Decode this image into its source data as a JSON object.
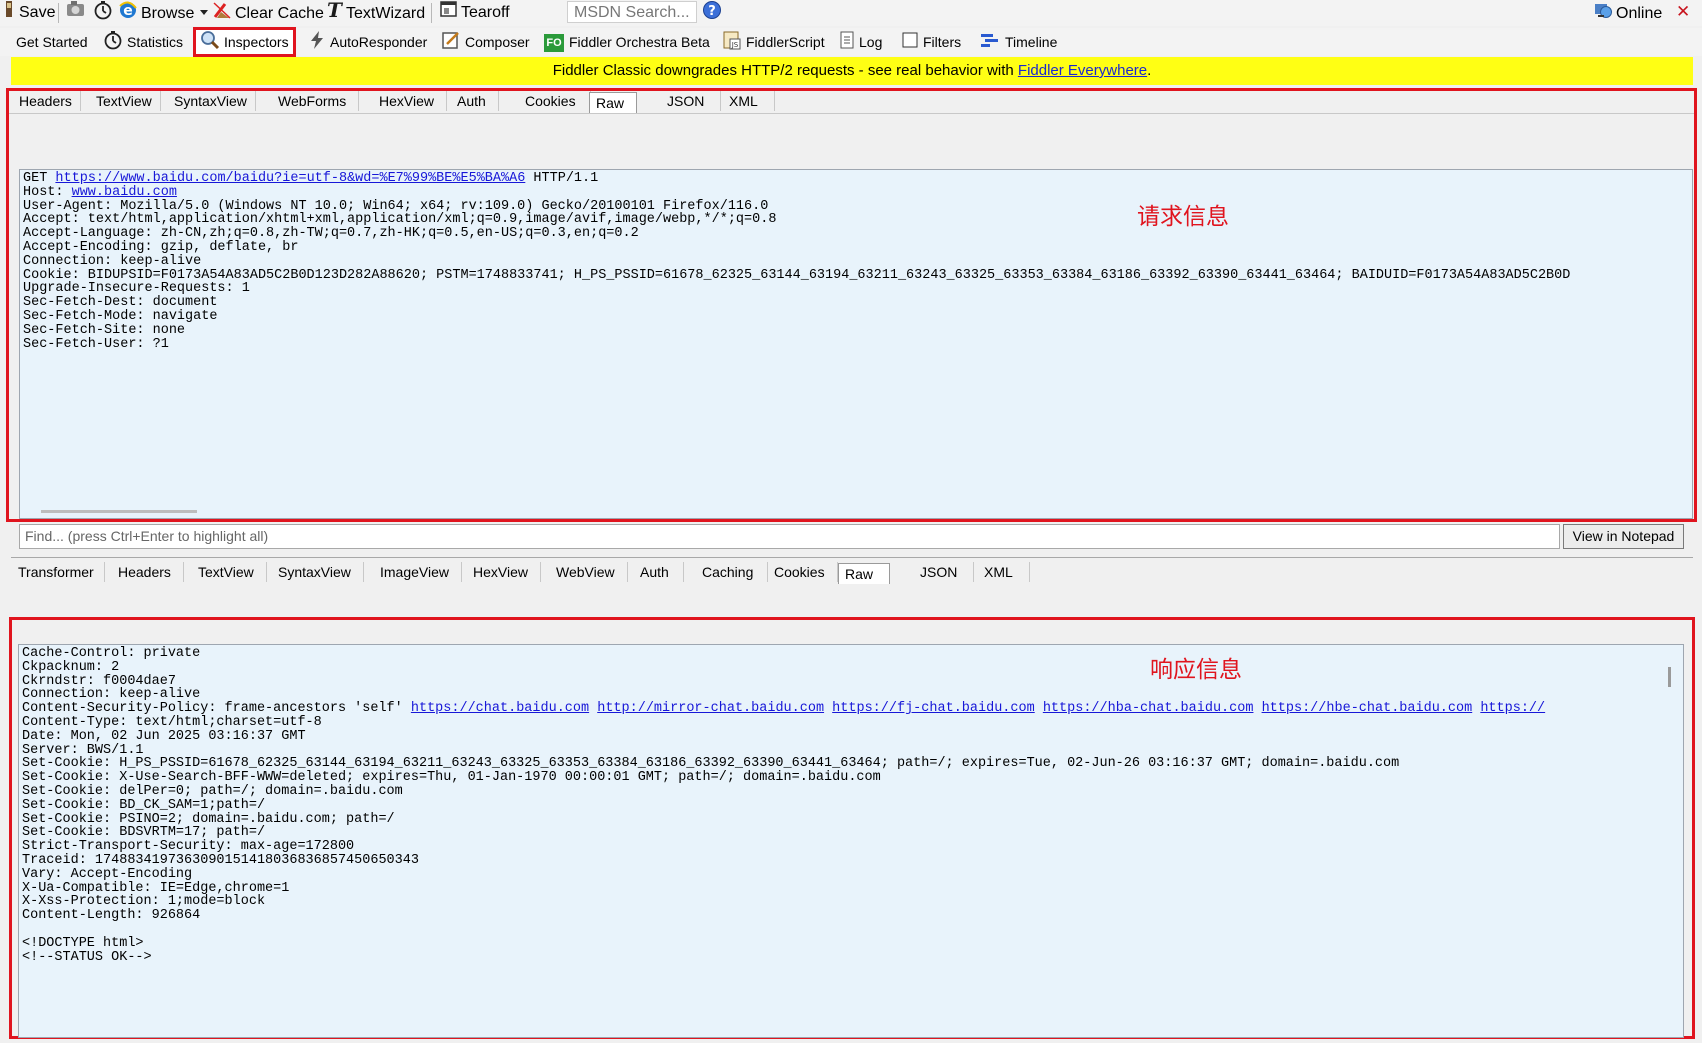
{
  "toolbar1": {
    "save": "Save",
    "browse": "Browse",
    "clear_cache": "Clear Cache",
    "textwizard": "TextWizard",
    "tearoff": "Tearoff",
    "msdn_search": "MSDN Search...",
    "online": "Online",
    "close": "✕"
  },
  "toolbar2": {
    "tabs": [
      "Get Started",
      "Statistics",
      "Inspectors",
      "AutoResponder",
      "Composer",
      "Fiddler Orchestra Beta",
      "FiddlerScript",
      "Log",
      "Filters",
      "Timeline"
    ],
    "orchestra_badge": "FO"
  },
  "banner": {
    "text": "Fiddler Classic downgrades HTTP/2 requests - see real behavior with ",
    "link": "Fiddler Everywhere",
    "suffix": "."
  },
  "request": {
    "tabs": [
      "Headers",
      "TextView",
      "SyntaxView",
      "WebForms",
      "HexView",
      "Auth",
      "Cookies",
      "Raw",
      "JSON",
      "XML"
    ],
    "selected_tab": "Raw",
    "method": "GET",
    "url": "https://www.baidu.com/baidu?ie=utf-8&wd=%E7%99%BE%E5%BA%A6",
    "protocol": " HTTP/1.1",
    "host_label": "Host: ",
    "host": "www.baidu.com",
    "lines": "User-Agent: Mozilla/5.0 (Windows NT 10.0; Win64; x64; rv:109.0) Gecko/20100101 Firefox/116.0\nAccept: text/html,application/xhtml+xml,application/xml;q=0.9,image/avif,image/webp,*/*;q=0.8\nAccept-Language: zh-CN,zh;q=0.8,zh-TW;q=0.7,zh-HK;q=0.5,en-US;q=0.3,en;q=0.2\nAccept-Encoding: gzip, deflate, br\nConnection: keep-alive\nCookie: BIDUPSID=F0173A54A83AD5C2B0D123D282A88620; PSTM=1748833741; H_PS_PSSID=61678_62325_63144_63194_63211_63243_63325_63353_63384_63186_63392_63390_63441_63464; BAIDUID=F0173A54A83AD5C2B0D\nUpgrade-Insecure-Requests: 1\nSec-Fetch-Dest: document\nSec-Fetch-Mode: navigate\nSec-Fetch-Site: none\nSec-Fetch-User: ?1",
    "annotation": "请求信息"
  },
  "find": {
    "placeholder": "Find... (press Ctrl+Enter to highlight all)",
    "view_in_notepad": "View in Notepad"
  },
  "response": {
    "tabs": [
      "Transformer",
      "Headers",
      "TextView",
      "SyntaxView",
      "ImageView",
      "HexView",
      "WebView",
      "Auth",
      "Caching",
      "Cookies",
      "Raw",
      "JSON",
      "XML"
    ],
    "selected_tab": "Raw",
    "lines_before": "Cache-Control: private\nCkpacknum: 2\nCkrndstr: f0004dae7\nConnection: keep-alive",
    "csp_label": "Content-Security-Policy: frame-ancestors 'self' ",
    "csp_links": [
      "https://chat.baidu.com",
      "http://mirror-chat.baidu.com",
      "https://fj-chat.baidu.com",
      "https://hba-chat.baidu.com",
      "https://hbe-chat.baidu.com",
      "https://"
    ],
    "lines_after": "Content-Type: text/html;charset=utf-8\nDate: Mon, 02 Jun 2025 03:16:37 GMT\nServer: BWS/1.1\nSet-Cookie: H_PS_PSSID=61678_62325_63144_63194_63211_63243_63325_63353_63384_63186_63392_63390_63441_63464; path=/; expires=Tue, 02-Jun-26 03:16:37 GMT; domain=.baidu.com\nSet-Cookie: X-Use-Search-BFF-WWW=deleted; expires=Thu, 01-Jan-1970 00:00:01 GMT; path=/; domain=.baidu.com\nSet-Cookie: delPer=0; path=/; domain=.baidu.com\nSet-Cookie: BD_CK_SAM=1;path=/\nSet-Cookie: PSINO=2; domain=.baidu.com; path=/\nSet-Cookie: BDSVRTM=17; path=/\nStrict-Transport-Security: max-age=172800\nTraceid: 1748834197363090151418036836857450650343\nVary: Accept-Encoding\nX-Ua-Compatible: IE=Edge,chrome=1\nX-Xss-Protection: 1;mode=block\nContent-Length: 926864\n\n<!DOCTYPE html>\n<!--STATUS OK-->",
    "annotation": "响应信息"
  },
  "colors": {
    "highlight_red": "#e0141e",
    "banner_yellow": "#ffff14",
    "pane_blue": "#e8f3fb",
    "link_blue": "#1717d8"
  },
  "icons": [
    "save-icon",
    "camera-icon",
    "timer-icon",
    "ie-browser-icon",
    "dropdown-arrow-icon",
    "clear-cache-icon",
    "textwizard-icon",
    "tearoff-icon",
    "help-icon",
    "online-globe-icon",
    "close-icon",
    "statistics-icon",
    "inspectors-icon",
    "autoresponder-icon",
    "composer-icon",
    "orchestra-icon",
    "fiddlerscript-icon",
    "log-icon",
    "filters-checkbox-icon",
    "timeline-icon"
  ]
}
